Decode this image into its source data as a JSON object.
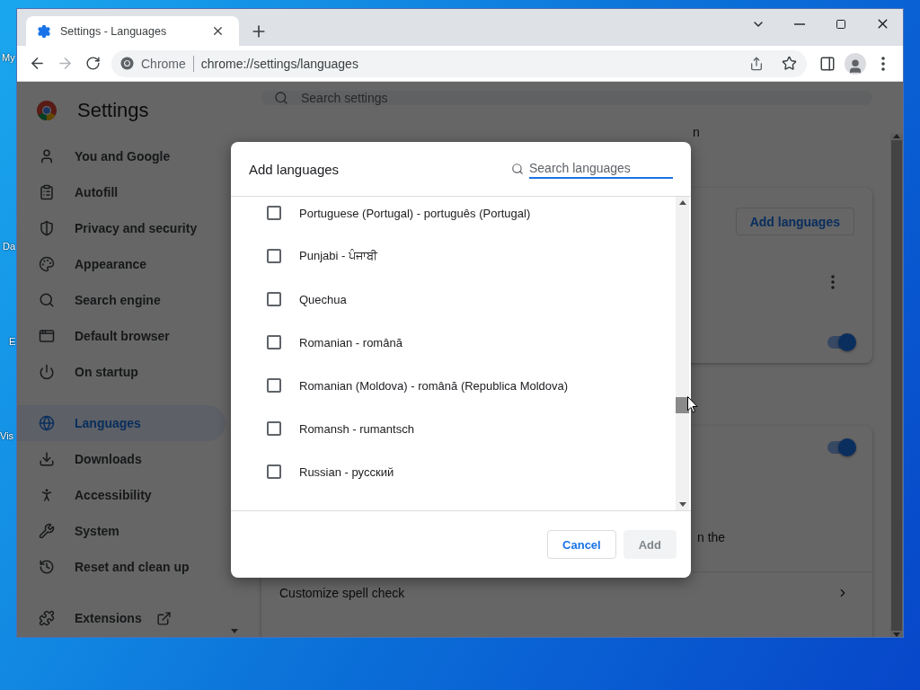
{
  "desktop": {
    "icon_labels": [
      "My",
      "Da",
      "E",
      "Vis"
    ]
  },
  "browser": {
    "tabs": [
      {
        "title": "Settings - Languages",
        "selected": true
      }
    ],
    "omnibox": {
      "site_label": "Chrome",
      "url": "chrome://settings/languages"
    }
  },
  "settings": {
    "title": "Settings",
    "search": {
      "placeholder": "Search settings"
    },
    "sidebar": {
      "groups": [
        [
          {
            "label": "You and Google",
            "selected": false
          },
          {
            "label": "Autofill",
            "selected": false
          },
          {
            "label": "Privacy and security",
            "selected": false
          },
          {
            "label": "Appearance",
            "selected": false
          },
          {
            "label": "Search engine",
            "selected": false
          },
          {
            "label": "Default browser",
            "selected": false
          },
          {
            "label": "On startup",
            "selected": false
          }
        ],
        [
          {
            "label": "Languages",
            "selected": true
          },
          {
            "label": "Downloads",
            "selected": false
          },
          {
            "label": "Accessibility",
            "selected": false
          },
          {
            "label": "System",
            "selected": false
          },
          {
            "label": "Reset and clean up",
            "selected": false
          }
        ],
        [
          {
            "label": "Extensions",
            "selected": false
          }
        ]
      ]
    },
    "main": {
      "fragment_top": "n",
      "card_1": {
        "add_button": "Add languages",
        "toggle_on": true
      },
      "card_2": {
        "toggle_on": true,
        "fragment": "n the",
        "link": "Customize spell check"
      }
    }
  },
  "dialog": {
    "title": "Add languages",
    "search": {
      "placeholder": "Search languages"
    },
    "languages": [
      {
        "label": "Portuguese (Portugal) - português (Portugal)",
        "checked": false
      },
      {
        "label": "Punjabi - ਪੰਜਾਬੀ",
        "checked": false
      },
      {
        "label": "Quechua",
        "checked": false
      },
      {
        "label": "Romanian - română",
        "checked": false
      },
      {
        "label": "Romanian (Moldova) - română (Republica Moldova)",
        "checked": false
      },
      {
        "label": "Romansh - rumantsch",
        "checked": false
      },
      {
        "label": "Russian - русский",
        "checked": false
      }
    ],
    "buttons": [
      {
        "label": "Cancel",
        "disabled": false
      },
      {
        "label": "Add",
        "disabled": true
      }
    ]
  }
}
